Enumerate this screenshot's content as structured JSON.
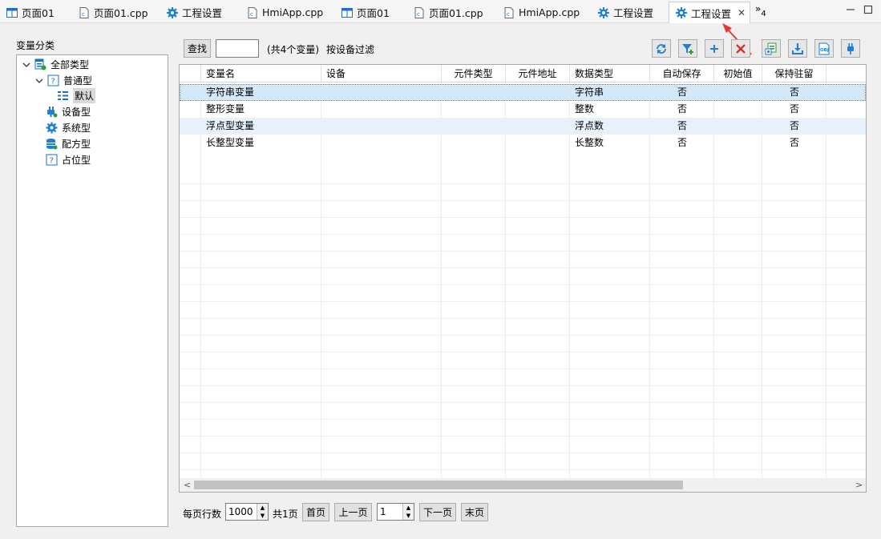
{
  "tabs": [
    {
      "label": "页面01",
      "icon": "page-icon"
    },
    {
      "label": "页面01.cpp",
      "icon": "cpp-file-icon"
    },
    {
      "label": "工程设置",
      "icon": "gear-icon"
    },
    {
      "label": "HmiApp.cpp",
      "icon": "cpp-file-icon"
    },
    {
      "label": "页面01",
      "icon": "page-icon"
    },
    {
      "label": "页面01.cpp",
      "icon": "cpp-file-icon"
    },
    {
      "label": "HmiApp.cpp",
      "icon": "cpp-file-icon"
    },
    {
      "label": "工程设置",
      "icon": "gear-icon"
    },
    {
      "label": "工程设置",
      "icon": "gear-icon",
      "active": true
    }
  ],
  "tab_overflow": {
    "glyph": "»",
    "count": "4"
  },
  "left_panel": {
    "title": "变量分类",
    "tree": [
      {
        "label": "全部类型",
        "icon": "all-types-icon",
        "expanded": true
      },
      {
        "label": "普通型",
        "icon": "question-box-icon",
        "expanded": true
      },
      {
        "label": "默认",
        "icon": "default-list-icon",
        "selected": true
      },
      {
        "label": "设备型",
        "icon": "plug-icon"
      },
      {
        "label": "系统型",
        "icon": "gear-icon"
      },
      {
        "label": "配方型",
        "icon": "database-icon"
      },
      {
        "label": "占位型",
        "icon": "question-box-icon"
      }
    ]
  },
  "search": {
    "button_label": "查找",
    "value": "",
    "count_text": "(共4个变量)",
    "filter_label": "按设备过滤"
  },
  "toolbar_icons": [
    "refresh-icon",
    "filter-add-icon",
    "add-icon",
    "delete-icon",
    "import-icon",
    "download-icon",
    "obj-export-icon",
    "connect-icon"
  ],
  "grid": {
    "columns": [
      "",
      "变量名",
      "设备",
      "元件类型",
      "元件地址",
      "数据类型",
      "自动保存",
      "初始值",
      "保持驻留"
    ],
    "rows": [
      {
        "name": "字符串变量",
        "device": "",
        "elem_type": "",
        "elem_addr": "",
        "data_type": "字符串",
        "auto_save": "否",
        "init": "",
        "retain": "否"
      },
      {
        "name": "整形变量",
        "device": "",
        "elem_type": "",
        "elem_addr": "",
        "data_type": "整数",
        "auto_save": "否",
        "init": "",
        "retain": "否"
      },
      {
        "name": "浮点型变量",
        "device": "",
        "elem_type": "",
        "elem_addr": "",
        "data_type": "浮点数",
        "auto_save": "否",
        "init": "",
        "retain": "否"
      },
      {
        "name": "长整型变量",
        "device": "",
        "elem_type": "",
        "elem_addr": "",
        "data_type": "长整数",
        "auto_save": "否",
        "init": "",
        "retain": "否"
      }
    ]
  },
  "pager": {
    "rows_per_page_label": "每页行数",
    "rows_per_page": "1000",
    "total_pages": "共1页",
    "first": "首页",
    "prev": "上一页",
    "page": "1",
    "next": "下一页",
    "last": "末页"
  },
  "colors": {
    "accent": "#1e7fd6",
    "selected_row": "#d5e8f7",
    "alt_row": "#e6f1fb",
    "annotation_arrow": "#e53935"
  }
}
